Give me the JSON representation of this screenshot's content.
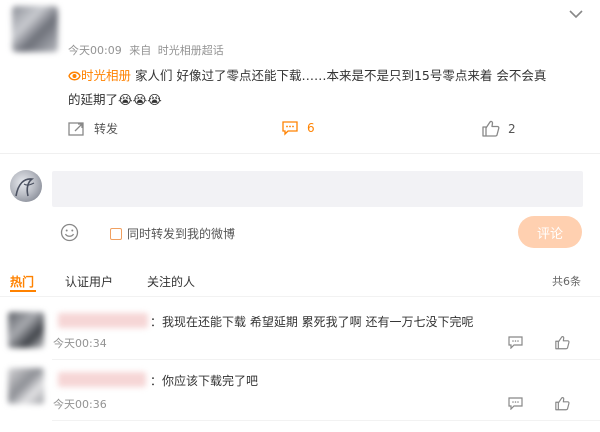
{
  "post": {
    "time": "今天00:09",
    "source_prefix": "来自",
    "source": "时光相册超话",
    "topic_tag": "时光相册",
    "text_line1": "家人们 好像过了零点还能下载……本来是不是只到15号零点来着 会不会真",
    "text_line2": "的延期了",
    "emoji": [
      "😭",
      "😭",
      "😭"
    ],
    "repost_label": "转发",
    "comment_count": "6",
    "like_count": "2"
  },
  "composer": {
    "placeholder": "",
    "checkbox_label": "同时转发到我的微博",
    "submit_label": "评论"
  },
  "filters": {
    "tabs": [
      "热门",
      "认证用户",
      "关注的人"
    ],
    "active_tab": "热门",
    "total": "共6条"
  },
  "comments": [
    {
      "text": "：我现在还能下载 希望延期 累死我了啊 还有一万七没下完呢",
      "time": "今天00:34"
    },
    {
      "text": "：你应该下载完了吧",
      "time": "今天00:36"
    }
  ],
  "colors": {
    "accent": "#ff8200",
    "button_bg": "#ffd0b0",
    "input_bg": "#f2f2f5"
  }
}
